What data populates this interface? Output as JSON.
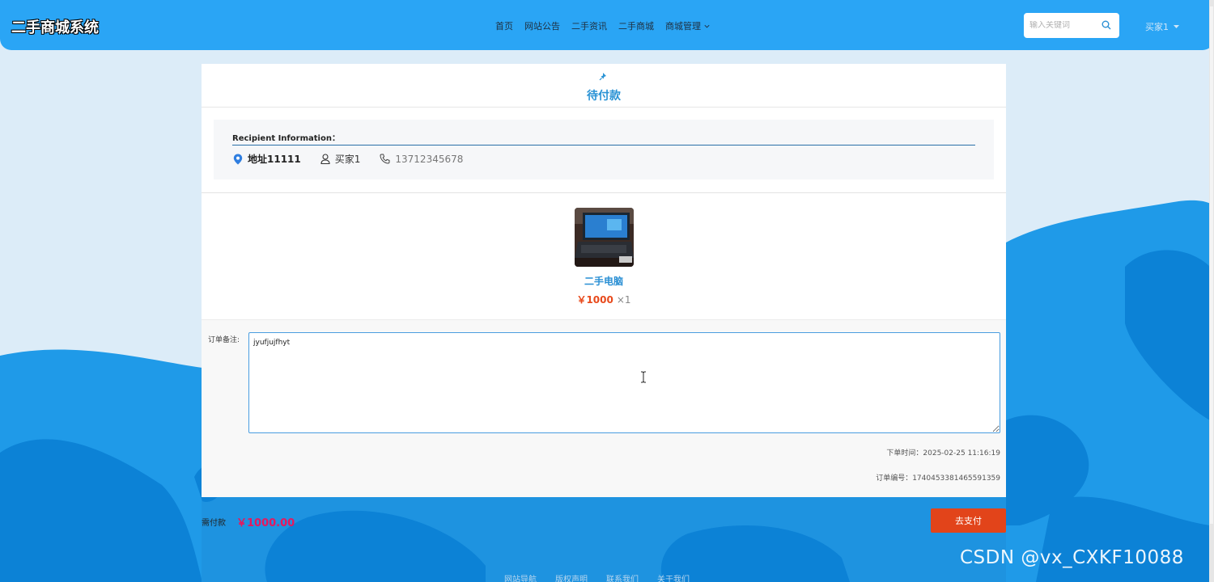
{
  "header": {
    "brand": "二手商城系统",
    "nav": [
      {
        "label": "首页"
      },
      {
        "label": "网站公告"
      },
      {
        "label": "二手资讯"
      },
      {
        "label": "二手商城"
      },
      {
        "label": "商城管理",
        "has_dropdown": true
      }
    ],
    "search_placeholder": "输入关键词",
    "user": "买家1"
  },
  "order": {
    "status": "待付款",
    "recipient_label": "Recipient Information：",
    "address": "地址11111",
    "name": "买家1",
    "phone": "13712345678",
    "product": {
      "name": "二手电脑",
      "price": "￥1000",
      "quantity": "×1"
    },
    "note_label": "订单备注:",
    "note_value": "jyufjujfhyt",
    "order_time": "下单时间：2025-02-25 11:16:19",
    "order_no": "订单编号：1740453381465591359"
  },
  "payment": {
    "label": "需付款",
    "amount": "￥1000.00",
    "button": "去支付"
  },
  "footer": {
    "links": [
      "网站导航",
      "版权声明",
      "联系我们",
      "关于我们"
    ]
  },
  "watermark": "CSDN @vx_CXKF10088",
  "colors": {
    "header": "#2aa5f5",
    "accent": "#2a93d5",
    "price": "#e84a1c",
    "pay_button": "#e2441a",
    "total": "#e8175d"
  }
}
